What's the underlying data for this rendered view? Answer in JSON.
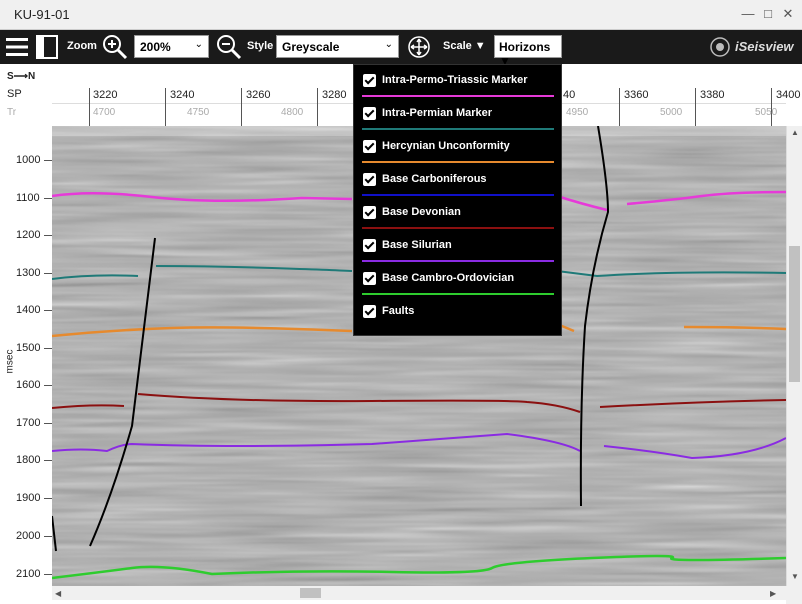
{
  "window": {
    "title": "KU-91-01"
  },
  "toolbar": {
    "zoom_label": "Zoom",
    "zoom_value": "200%",
    "style_label": "Style",
    "style_value": "Greyscale",
    "scale_label": "Scale ▼",
    "horizons_label": "Horizons ▼",
    "brand": "iSeisview"
  },
  "axes": {
    "direction": "S⟶N",
    "sp_label": "SP",
    "tr_label": "Tr",
    "sp_ticks": [
      "3220",
      "3240",
      "3260",
      "3280",
      "40",
      "3360",
      "3380",
      "3400"
    ],
    "tr_ticks": [
      "4700",
      "4750",
      "4800",
      "4950",
      "5000",
      "5050"
    ],
    "y_unit": "msec",
    "y_ticks": [
      "1000",
      "1100",
      "1200",
      "1300",
      "1400",
      "1500",
      "1600",
      "1700",
      "1800",
      "1900",
      "2000",
      "2100"
    ]
  },
  "horizons": [
    {
      "label": "Intra-Permo-Triassic Marker",
      "color": "#e63ad8",
      "checked": true
    },
    {
      "label": "Intra-Permian Marker",
      "color": "#1f7a78",
      "checked": true
    },
    {
      "label": "Hercynian Unconformity",
      "color": "#e68a2e",
      "checked": true
    },
    {
      "label": "Base Carboniferous",
      "color": "#1010c8",
      "checked": true
    },
    {
      "label": "Base Devonian",
      "color": "#8b1010",
      "checked": true
    },
    {
      "label": "Base Silurian",
      "color": "#8a2be2",
      "checked": true
    },
    {
      "label": "Base Cambro-Ordovician",
      "color": "#2ecc2e",
      "checked": true
    },
    {
      "label": "Faults",
      "color": "#000000",
      "checked": true
    }
  ]
}
